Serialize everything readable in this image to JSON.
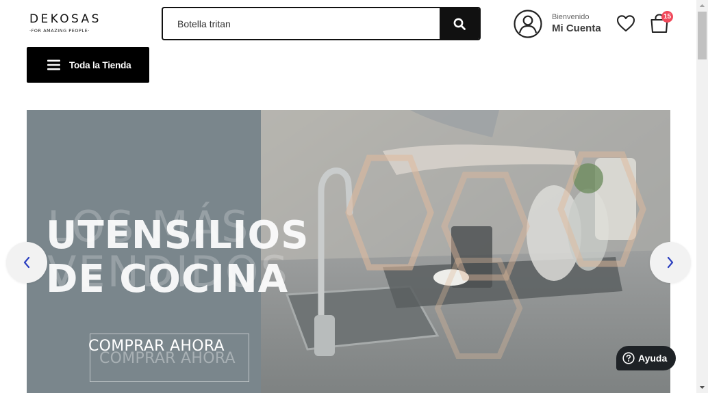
{
  "header": {
    "logo": {
      "word": "DEKOSAS",
      "tagline": "·FOR AMAZING PEOPLE·"
    },
    "search": {
      "value": "Botella tritan",
      "icon": "search-icon"
    },
    "account": {
      "greeting": "Bienvenido",
      "label": "Mi Cuenta",
      "icon": "user-circle-icon"
    },
    "wishlist": {
      "icon": "heart-icon"
    },
    "cart": {
      "icon": "shopping-bag-icon",
      "count": "15"
    }
  },
  "nav": {
    "all_store_label": "Toda la Tienda",
    "icon": "menu-icon"
  },
  "hero": {
    "headline_line1": "UTENSILIOS",
    "headline_line2": "DE COCINA",
    "ghost_line1": "LOS MÁS",
    "ghost_line2": "VENDIDOS",
    "cta_label": "COMPRAR AHORA",
    "cta_ghost": "COMPRAR AHORA",
    "prev_icon": "chevron-left-icon",
    "next_icon": "chevron-right-icon"
  },
  "help": {
    "label": "Ayuda",
    "icon": "question-circle-icon"
  },
  "colors": {
    "accent": "#111111",
    "badge": "#f0485a",
    "arrow": "#2b3fbf",
    "hero_panel": "#7a868c"
  }
}
